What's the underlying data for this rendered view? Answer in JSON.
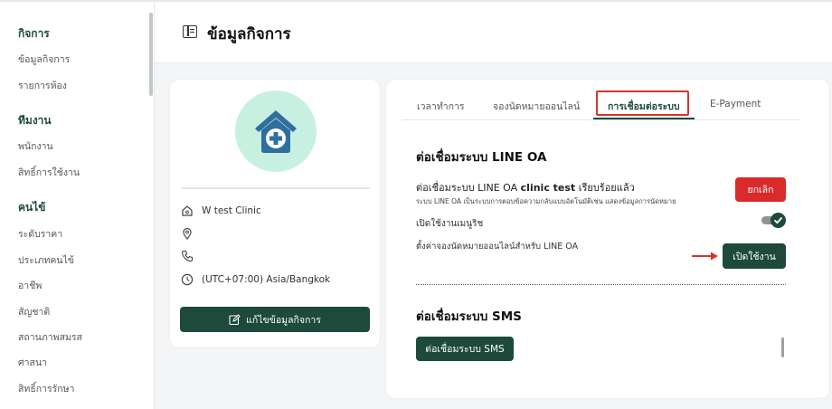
{
  "sidebar": {
    "groups": [
      {
        "label": "กิจการ",
        "items": [
          "ข้อมูลกิจการ",
          "รายการห้อง"
        ]
      },
      {
        "label": "ทีมงาน",
        "items": [
          "พนักงาน",
          "สิทธิ์การใช้งาน"
        ]
      },
      {
        "label": "คนไข้",
        "items": [
          "ระดับราคา",
          "ประเภทคนไข้",
          "อาชีพ",
          "สัญชาติ",
          "สถานภาพสมรส",
          "ศาสนา",
          "สิทธิ์การรักษา"
        ]
      }
    ]
  },
  "header": {
    "title": "ข้อมูลกิจการ"
  },
  "business": {
    "name": "W test Clinic",
    "address": "",
    "phone": "",
    "timezone": "(UTC+07:00) Asia/Bangkok",
    "edit_label": "แก้ไขข้อมูลกิจการ"
  },
  "tabs": [
    {
      "label": "เวลาทำการ"
    },
    {
      "label": "จองนัดหมายออนไลน์"
    },
    {
      "label": "การเชื่อมต่อระบบ",
      "active": true
    },
    {
      "label": "E-Payment"
    }
  ],
  "line_oa": {
    "title": "ต่อเชื่อมระบบ LINE OA",
    "status_prefix": "ต่อเชื่อมระบบ LINE OA ",
    "status_name": "clinic test",
    "status_suffix": " เรียบร้อยแล้ว",
    "description": "ระบบ LINE OA เป็นระบบการตอบข้อความกลับแบบอัตโนมัติเช่น แสดงข้อมูลการนัดหมาย",
    "cancel_label": "ยกเลิก",
    "menu_label": "เปิดใช้งานเมนูริช",
    "menu_enabled": true,
    "booking_label": "ตั้งค่าจองนัดหมายออนไลน์สำหรับ LINE OA",
    "enable_label": "เปิดใช้งาน"
  },
  "sms": {
    "title": "ต่อเชื่อมระบบ SMS",
    "button_label": "ต่อเชื่อมระบบ SMS"
  },
  "colors": {
    "primary": "#1d4a3a",
    "danger": "#d92b2b",
    "highlight": "#d9342b",
    "logo_bg": "#c8f0e0",
    "logo_fg": "#2f6f9f"
  }
}
